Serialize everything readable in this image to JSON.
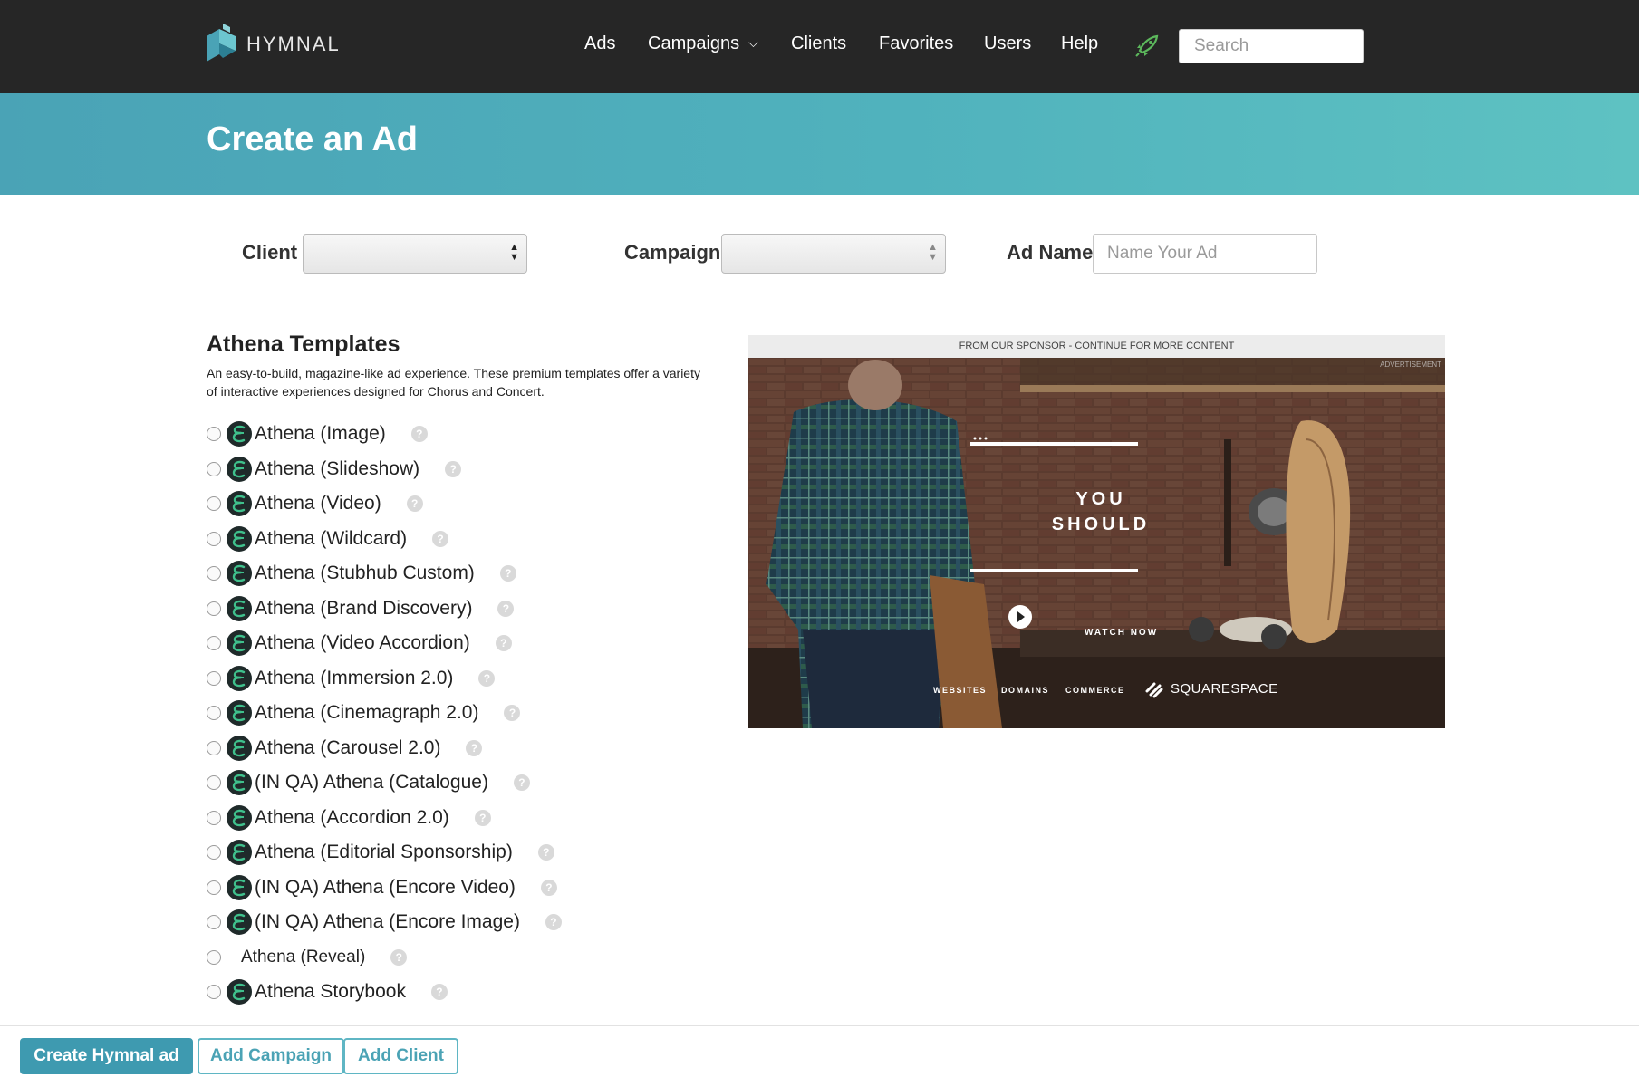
{
  "app": {
    "name": "HYMNAL"
  },
  "nav": {
    "items": [
      {
        "label": "Ads"
      },
      {
        "label": "Campaigns"
      },
      {
        "label": "Clients"
      },
      {
        "label": "Favorites"
      },
      {
        "label": "Users"
      },
      {
        "label": "Help"
      }
    ],
    "search_placeholder": "Search",
    "rocket_color": "#5cb85c"
  },
  "banner": {
    "title": "Create an Ad",
    "colors": [
      "#4aa3b6",
      "#5ec2c2"
    ]
  },
  "form": {
    "client_label": "Client",
    "client_value": "",
    "campaign_label": "Campaign",
    "campaign_value": "",
    "ad_name_label": "Ad Name",
    "ad_name_placeholder": "Name Your Ad",
    "ad_name_value": ""
  },
  "templates": {
    "title": "Athena Templates",
    "description": "An easy-to-build, magazine-like ad experience. These premium templates offer a variety of interactive experiences designed for Chorus and Concert.",
    "items": [
      {
        "label": "Athena (Image)",
        "icon": "athena-icon",
        "selected": false
      },
      {
        "label": "Athena (Slideshow)",
        "icon": "athena-icon",
        "selected": false
      },
      {
        "label": "Athena (Video)",
        "icon": "athena-icon",
        "selected": false
      },
      {
        "label": "Athena (Wildcard)",
        "icon": "athena-icon",
        "selected": false
      },
      {
        "label": "Athena (Stubhub Custom)",
        "icon": "athena-icon",
        "selected": false
      },
      {
        "label": "Athena (Brand Discovery)",
        "icon": "athena-icon",
        "selected": false
      },
      {
        "label": "Athena (Video Accordion)",
        "icon": "athena-icon",
        "selected": false
      },
      {
        "label": "Athena (Immersion 2.0)",
        "icon": "athena-icon",
        "selected": false
      },
      {
        "label": "Athena (Cinemagraph 2.0)",
        "icon": "athena-icon",
        "selected": false
      },
      {
        "label": "Athena (Carousel 2.0)",
        "icon": "athena-icon",
        "selected": false
      },
      {
        "label": "(IN QA) Athena (Catalogue)",
        "icon": "athena-icon",
        "selected": false
      },
      {
        "label": "Athena (Accordion 2.0)",
        "icon": "athena-icon",
        "selected": false
      },
      {
        "label": "Athena (Editorial Sponsorship)",
        "icon": "athena-icon",
        "selected": false
      },
      {
        "label": "(IN QA) Athena (Encore Video)",
        "icon": "athena-icon",
        "selected": false
      },
      {
        "label": "(IN QA) Athena (Encore Image)",
        "icon": "athena-icon",
        "selected": false
      },
      {
        "label": "Athena (Reveal)",
        "icon": "",
        "selected": false
      },
      {
        "label": "Athena Storybook",
        "icon": "athena-icon",
        "selected": false
      }
    ],
    "help_glyph": "?"
  },
  "preview": {
    "sponsor_bar": "FROM OUR SPONSOR - CONTINUE FOR MORE CONTENT",
    "corner_text": "ADVERTISEMENT",
    "headline_line1": "YOU",
    "headline_line2": "SHOULD",
    "watch_label": "WATCH NOW",
    "footer_links": [
      "WEBSITES",
      "DOMAINS",
      "COMMERCE"
    ],
    "brand": "SQUARESPACE"
  },
  "footer": {
    "create_label": "Create Hymnal ad",
    "add_campaign_label": "Add Campaign",
    "add_client_label": "Add Client",
    "accent_color": "#3e9ab0"
  }
}
